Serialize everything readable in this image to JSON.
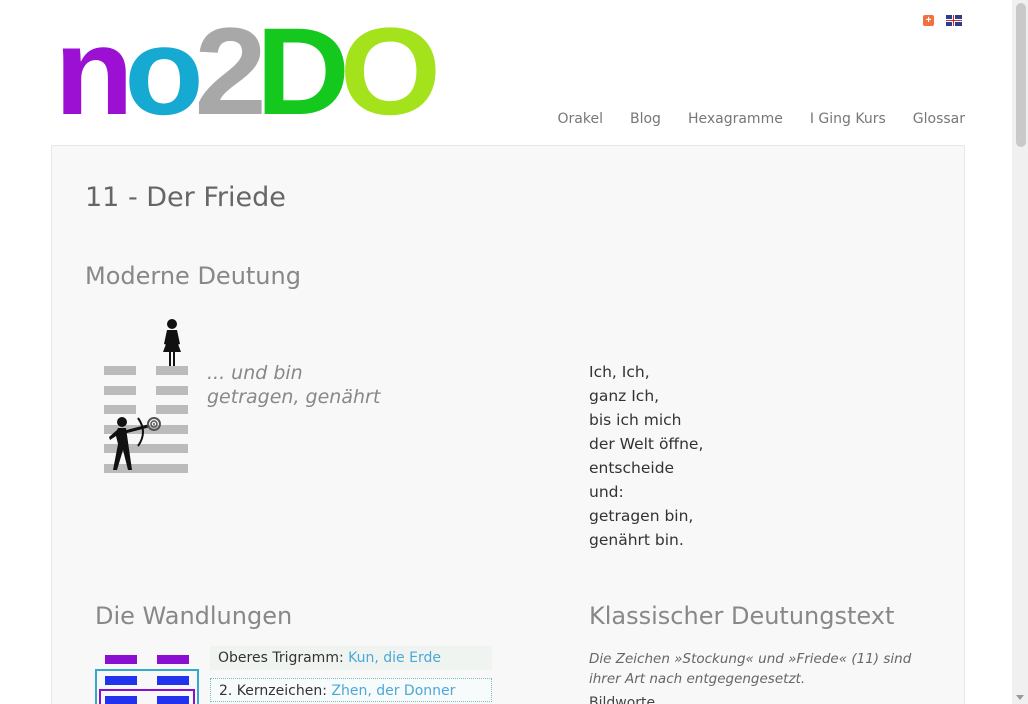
{
  "logo": {
    "letters": [
      {
        "char": "n",
        "color": "#9b10d2"
      },
      {
        "char": "o",
        "color": "#16a9d2"
      },
      {
        "char": "2",
        "color": "#a8a8a8"
      },
      {
        "char": "D",
        "color": "#14c81e"
      },
      {
        "char": "O",
        "color": "#a4e21c"
      }
    ]
  },
  "languages": {
    "de_icon": "plus-icon",
    "en_icon": "uk-flag-icon",
    "de_label": "+"
  },
  "nav": {
    "items": [
      "Orakel",
      "Blog",
      "Hexagramme",
      "I Ging Kurs",
      "Glossar"
    ]
  },
  "page": {
    "title": "11 - Der Friede",
    "modern_heading": "Moderne Deutung",
    "motto_line1": "... und bin",
    "motto_line2": "getragen, genährt",
    "poem": [
      "Ich, Ich,",
      "ganz Ich,",
      "bis ich mich",
      "der Welt öffne,",
      "entscheide",
      "und:",
      "getragen bin,",
      "genährt bin."
    ],
    "changes_heading": "Die Wandlungen",
    "classic_heading": "Klassischer Deutungstext",
    "upper_trigram_label": "Oberes Trigramm:",
    "upper_trigram_link": "Kun, die Erde",
    "core_sign_label": "2. Kernzeichen:",
    "core_sign_link": "Zhen, der Donner",
    "classic_intro": "Die Zeichen »Stockung« und »Friede« (11) sind ihrer Art nach entgegengesetzt.",
    "classic_next": "Bildworte"
  },
  "colors": {
    "hex_line": "#bbbbbb",
    "purple": "#8a0fd0",
    "blue": "#2233ee",
    "teal": "#33aacc",
    "link": "#4aa8d8"
  }
}
